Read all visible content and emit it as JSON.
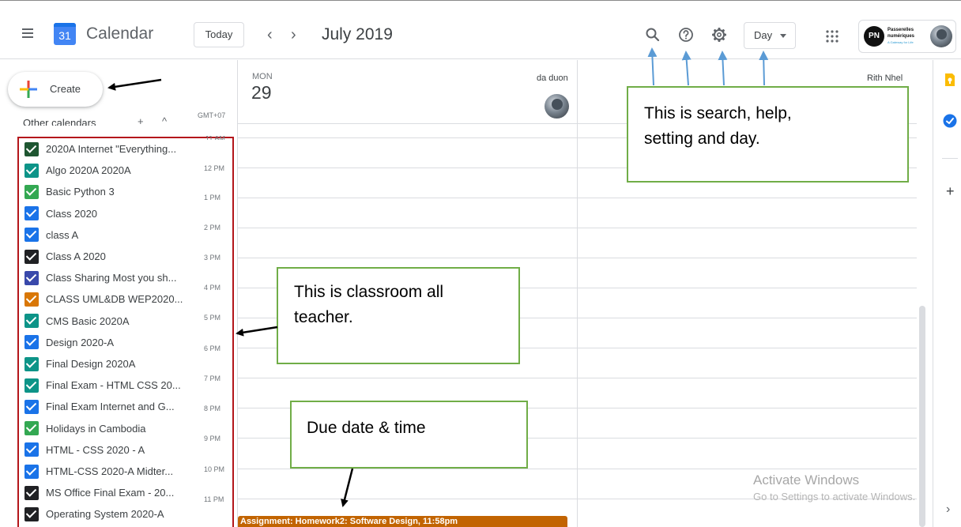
{
  "header": {
    "app_title": "Calendar",
    "logo_day": "31",
    "today_label": "Today",
    "prev_label": "‹",
    "next_label": "›",
    "month_title": "July 2019",
    "view_label": "Day",
    "account": {
      "logo_text": "PN",
      "org_line1": "Passerelles",
      "org_line2": "numériques",
      "org_tagline": "A Gateway for Life"
    }
  },
  "sidebar": {
    "create_label": "Create",
    "other_calendars_label": "Other calendars",
    "add_label": "+",
    "collapse_label": "^",
    "calendars": [
      {
        "name": "2020A Internet \"Everything...",
        "color": "#1e5631"
      },
      {
        "name": "Algo 2020A 2020A",
        "color": "#0d9488"
      },
      {
        "name": "Basic Python 3",
        "color": "#33a852"
      },
      {
        "name": "Class 2020",
        "color": "#1a73e8"
      },
      {
        "name": "class A",
        "color": "#1a73e8"
      },
      {
        "name": "Class A 2020",
        "color": "#202124"
      },
      {
        "name": "Class Sharing Most you sh...",
        "color": "#3949ab"
      },
      {
        "name": "CLASS UML&DB WEP2020...",
        "color": "#d97706"
      },
      {
        "name": "CMS Basic 2020A",
        "color": "#0d9488"
      },
      {
        "name": "Design 2020-A",
        "color": "#1a73e8"
      },
      {
        "name": "Final Design 2020A",
        "color": "#0d9488"
      },
      {
        "name": "Final Exam - HTML CSS 20...",
        "color": "#0d9488"
      },
      {
        "name": "Final Exam Internet and G...",
        "color": "#1a73e8"
      },
      {
        "name": "Holidays in Cambodia",
        "color": "#33a852"
      },
      {
        "name": "HTML - CSS 2020 - A",
        "color": "#1a73e8"
      },
      {
        "name": "HTML-CSS 2020-A Midter...",
        "color": "#1a73e8"
      },
      {
        "name": "MS Office Final Exam - 20...",
        "color": "#202124"
      },
      {
        "name": "Operating System 2020-A",
        "color": "#202124"
      }
    ]
  },
  "day_view": {
    "timezone": "GMT+07",
    "day_name": "MON",
    "day_number": "29",
    "resources": [
      "da duon",
      "Rith Nhel"
    ],
    "time_labels": [
      "11 AM",
      "12 PM",
      "1 PM",
      "2 PM",
      "3 PM",
      "4 PM",
      "5 PM",
      "6 PM",
      "7 PM",
      "8 PM",
      "9 PM",
      "10 PM",
      "11 PM"
    ],
    "event_label": "Assignment: Homework2: Software Design, 11:58pm",
    "event_color": "#c26401"
  },
  "side_panel": {
    "add_label": "+",
    "expand_label": "›"
  },
  "annotations": {
    "header_callout_line1": "This is search, help,",
    "header_callout_line2": "setting and day.",
    "list_callout_line1": "This is classroom all",
    "list_callout_line2": "teacher.",
    "due_callout": "Due date & time",
    "callout_border_color": "#70ad47",
    "list_outline_color": "#b4161b"
  },
  "watermark": {
    "title": "Activate Windows",
    "subtitle": "Go to Settings to activate Windows."
  }
}
